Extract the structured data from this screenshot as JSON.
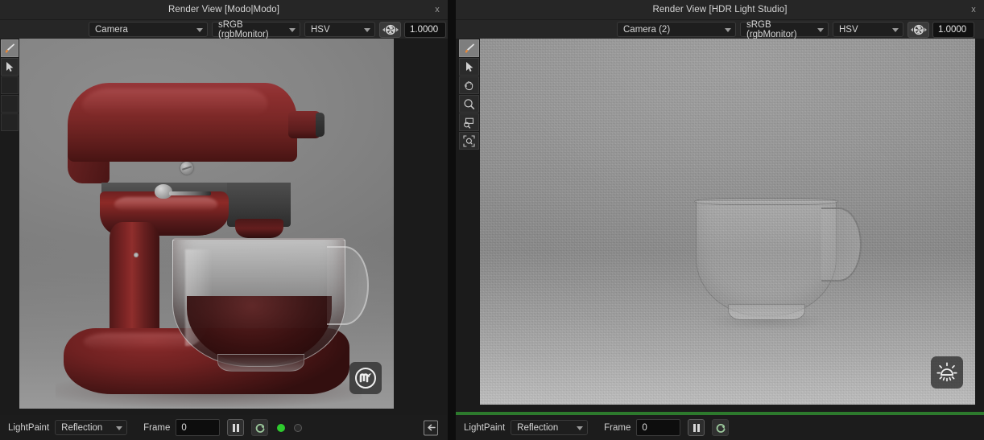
{
  "window": {
    "left_panel": {
      "title": "Render View [Modo|Modo]",
      "close_label": "x",
      "toolbar": {
        "camera": "Camera",
        "colorspace": "sRGB (rgbMonitor)",
        "mode": "HSV",
        "exposure": "1.0000",
        "aperture_icon": "aperture-icon"
      },
      "tools": [
        {
          "name": "brush-tool",
          "icon": "brush-icon",
          "selected": true
        },
        {
          "name": "select-tool",
          "icon": "arrow-cursor-icon",
          "selected": false
        },
        {
          "name": "tool-slot-3",
          "icon": "blank-icon",
          "selected": false
        },
        {
          "name": "tool-slot-4",
          "icon": "blank-icon",
          "selected": false
        },
        {
          "name": "tool-slot-5",
          "icon": "blank-icon",
          "selected": false
        }
      ],
      "watermark": "modo-logo-icon",
      "statusbar": {
        "lightpaint_label": "LightPaint",
        "mode": "Reflection",
        "frame_label": "Frame",
        "frame_value": "0",
        "pause_icon": "pause-icon",
        "refresh_icon": "refresh-icon",
        "indicator_on": "status-dot-active",
        "indicator_off": "status-dot-inactive",
        "collapse_icon": "collapse-left-icon"
      }
    },
    "right_panel": {
      "title": "Render View [HDR Light Studio]",
      "close_label": "x",
      "toolbar": {
        "camera": "Camera (2)",
        "colorspace": "sRGB (rgbMonitor)",
        "mode": "HSV",
        "exposure": "1.0000",
        "aperture_icon": "aperture-icon"
      },
      "tools": [
        {
          "name": "brush-tool",
          "icon": "brush-icon",
          "selected": true
        },
        {
          "name": "select-tool",
          "icon": "arrow-cursor-icon",
          "selected": false
        },
        {
          "name": "pan-tool",
          "icon": "hand-icon",
          "selected": false
        },
        {
          "name": "zoom-tool",
          "icon": "magnifier-icon",
          "selected": false
        },
        {
          "name": "zoom-region-tool",
          "icon": "zoom-region-icon",
          "selected": false
        },
        {
          "name": "zoom-fit-tool",
          "icon": "zoom-fit-icon",
          "selected": false
        }
      ],
      "watermark": "hdr-light-studio-sun-icon",
      "render_progress_percent": 100,
      "statusbar": {
        "lightpaint_label": "LightPaint",
        "mode": "Reflection",
        "frame_label": "Frame",
        "frame_value": "0",
        "pause_icon": "pause-icon",
        "refresh_icon": "refresh-icon"
      }
    }
  },
  "colors": {
    "panel_bg": "#1b1b1b",
    "titlebar_bg": "#262626",
    "accent_green": "#2d7a2d",
    "mixer_red": "#8d2f2f",
    "text": "#d6d6d6"
  }
}
